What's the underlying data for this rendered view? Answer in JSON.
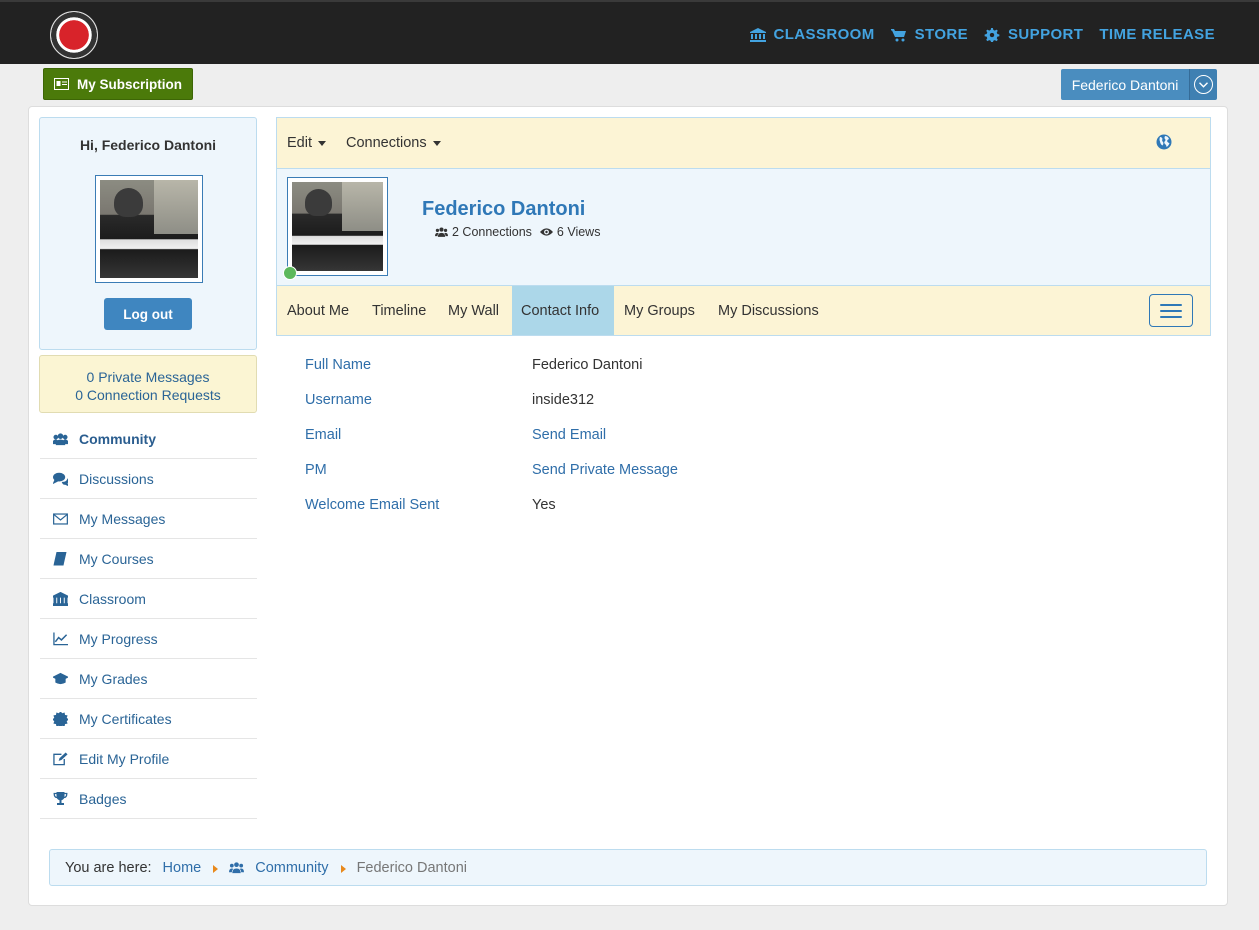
{
  "topnav": {
    "logo_alt": "Music logo",
    "items": [
      {
        "label": "CLASSROOM",
        "icon": "bank-icon"
      },
      {
        "label": "STORE",
        "icon": "cart-icon"
      },
      {
        "label": "SUPPORT",
        "icon": "gear-icon"
      },
      {
        "label": "TIME RELEASE",
        "icon": ""
      }
    ]
  },
  "subscription": {
    "label": "My Subscription",
    "icon": "id-card-icon"
  },
  "user_menu": {
    "label": "Federico Dantoni",
    "icon": "chevron-down-circle-icon"
  },
  "sidebar": {
    "greeting": "Hi, Federico Dantoni",
    "logout_label": "Log out",
    "private_messages": "0 Private Messages",
    "connection_requests": "0 Connection Requests",
    "menu": [
      {
        "label": "Community",
        "icon": "users-icon"
      },
      {
        "label": "Discussions",
        "icon": "comments-icon"
      },
      {
        "label": "My Messages",
        "icon": "envelope-icon"
      },
      {
        "label": "My Courses",
        "icon": "book-icon"
      },
      {
        "label": "Classroom",
        "icon": "bank-icon"
      },
      {
        "label": "My Progress",
        "icon": "line-chart-icon"
      },
      {
        "label": "My Grades",
        "icon": "graduation-cap-icon"
      },
      {
        "label": "My Certificates",
        "icon": "certificate-icon"
      },
      {
        "label": "Edit My Profile",
        "icon": "edit-icon"
      },
      {
        "label": "Badges",
        "icon": "trophy-icon"
      }
    ]
  },
  "toolbar": {
    "edit_label": "Edit",
    "connections_label": "Connections",
    "globe_icon": "globe-icon"
  },
  "profile": {
    "name": "Federico Dantoni",
    "connections": "2 Connections",
    "views": "6 Views",
    "online": true
  },
  "tabs": [
    {
      "label": "About Me",
      "active": false
    },
    {
      "label": "Timeline",
      "active": false
    },
    {
      "label": "My Wall",
      "active": false
    },
    {
      "label": "Contact Info",
      "active": true
    },
    {
      "label": "My Groups",
      "active": false
    },
    {
      "label": "My Discussions",
      "active": false
    }
  ],
  "contact_info": [
    {
      "label": "Full Name",
      "value": "Federico Dantoni",
      "link": false
    },
    {
      "label": "Username",
      "value": "inside312",
      "link": false
    },
    {
      "label": "Email",
      "value": "Send Email",
      "link": true
    },
    {
      "label": "PM",
      "value": "Send Private Message",
      "link": true
    },
    {
      "label": "Welcome Email Sent",
      "value": "Yes",
      "link": false
    }
  ],
  "breadcrumb": {
    "prefix": "You are here:",
    "home": "Home",
    "community": "Community",
    "current": "Federico Dantoni"
  },
  "colors": {
    "nav_link": "#43a3e0",
    "subscription_green": "#4b7a0a",
    "user_blue": "#4a8dbf",
    "active_tab": "#acd7e9",
    "panel_yellow": "#fcf4d5",
    "panel_blue": "#eef6fc"
  }
}
